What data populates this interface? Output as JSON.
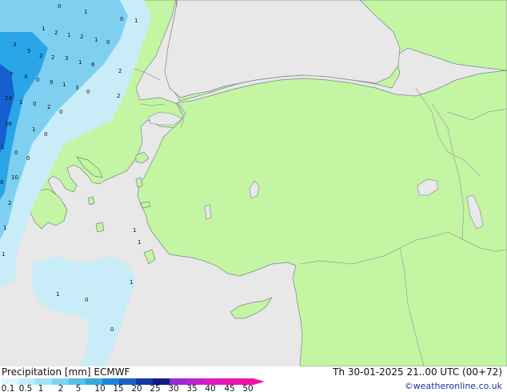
{
  "map": {
    "colors": {
      "sea": "#e8e8e8",
      "land": "#c3f5a3",
      "border": "#9aa0a0",
      "coast": "#7b8388",
      "precip_light": "#c8ecf8",
      "precip_mid": "#7fd0f0",
      "precip_heavy": "#2aa5e8",
      "precip_dark": "#1560d0"
    },
    "precip_values": [
      "0",
      "1",
      "0",
      "1",
      "1",
      "2",
      "1",
      "2",
      "1",
      "0",
      "3",
      "5",
      "2",
      "2",
      "3",
      "1",
      "6",
      "2",
      "7",
      "4",
      "0",
      "9",
      "1",
      "3",
      "0",
      "2",
      "14",
      "1",
      "0",
      "2",
      "0",
      "16",
      "1",
      "0",
      "1",
      "0",
      "0",
      "10",
      "0",
      "2",
      "1",
      "1",
      "1",
      "1",
      "1",
      "0",
      "1",
      "0"
    ]
  },
  "legend": {
    "title": "Precipitation [mm]  ECMWF",
    "datetime": "Th 30-01-2025 21..00 UTC (00+72)",
    "credit": "©weatheronline.co.uk",
    "ticks": [
      "0.1",
      "0.5",
      "1",
      "2",
      "5",
      "10",
      "15",
      "20",
      "25",
      "30",
      "35",
      "40",
      "45",
      "50"
    ],
    "colors": [
      "#dff6fb",
      "#c0eef9",
      "#9ee2f4",
      "#7ad4f0",
      "#55c1ea",
      "#33a9e2",
      "#1e86d6",
      "#1a5fc6",
      "#123aa8",
      "#0a1e86",
      "#9a28d6",
      "#c21ed0",
      "#de18c4",
      "#e814b4",
      "#f012a8"
    ]
  }
}
